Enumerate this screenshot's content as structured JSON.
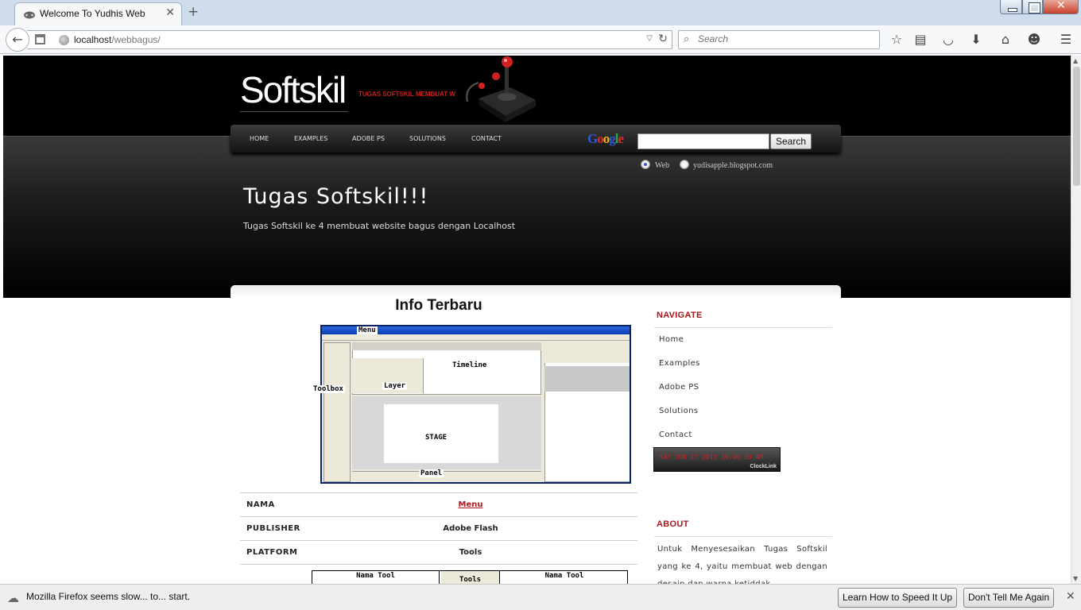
{
  "browser": {
    "tab_title": "Welcome To Yudhis Web",
    "close_glyph": "✕",
    "new_tab_glyph": "+",
    "url_host": "localhost",
    "url_path": "/webbagus/",
    "search_placeholder": "Search"
  },
  "site": {
    "logo": "Softskil",
    "tagline": "TUGAS SOFTSKIL MEMBUAT W",
    "nav": [
      "HOME",
      "EXAMPLES",
      "ADOBE PS",
      "SOLUTIONS",
      "CONTACT"
    ],
    "search_button": "Search",
    "radio_web": "Web",
    "radio_site": "yudisapple.blogspot.com",
    "hero_title": "Tugas Softskil!!!",
    "hero_sub": "Tugas Softskil ke 4 membuat website bagus dengan Localhost"
  },
  "content": {
    "title": "Info Terbaru",
    "image_labels": {
      "menu": "Menu",
      "timeline": "Timeline",
      "layer": "Layer",
      "toolbox": "Toolbox",
      "stage": "STAGE",
      "panel": "Panel"
    },
    "rows": [
      {
        "key": "NAMA",
        "value": "Menu"
      },
      {
        "key": "PUBLISHER",
        "value": "Adobe Flash"
      },
      {
        "key": "PLATFORM",
        "value": "Tools"
      }
    ],
    "tool_table": {
      "col1": "Nama Tool",
      "col2": "Tools",
      "col3": "Nama Tool"
    }
  },
  "sidebar": {
    "navigate_head": "NAVIGATE",
    "links": [
      "Home",
      "Examples",
      "Adobe PS",
      "Solutions",
      "Contact"
    ],
    "clock_text": "SAT JUN 27 2015 10:46:39 AM",
    "clock_brand": "ClockLink",
    "about_head": "ABOUT",
    "about_text": "Untuk Menyesesaikan Tugas Softskil yang ke 4, yaitu membuat web dengan desain dan warna ketiddak"
  },
  "notification": {
    "text": "Mozilla Firefox seems slow... to... start.",
    "learn_button": "Learn How to Speed It Up",
    "dont_button": "Don't Tell Me Again"
  }
}
